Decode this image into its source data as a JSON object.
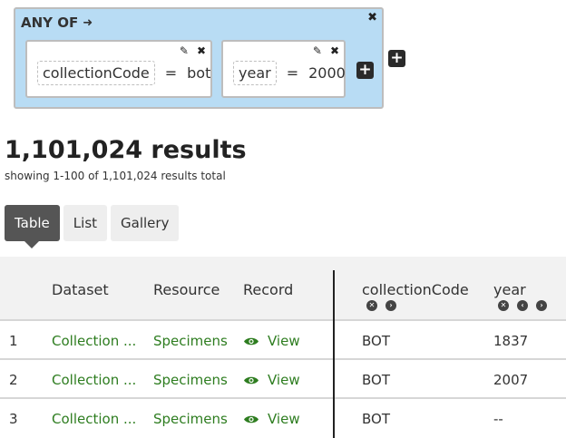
{
  "filter": {
    "group_title": "ANY OF",
    "clauses": [
      {
        "field": "collectionCode",
        "op": "=",
        "value": "bot"
      },
      {
        "field": "year",
        "op": "=",
        "value": "2000"
      }
    ]
  },
  "results": {
    "count": "1,101,024 results",
    "showing": "showing 1-100 of 1,101,024 results total"
  },
  "tabs": [
    {
      "label": "Table",
      "active": true
    },
    {
      "label": "List",
      "active": false
    },
    {
      "label": "Gallery",
      "active": false
    }
  ],
  "table": {
    "headers": [
      "Dataset",
      "Resource",
      "Record",
      "collectionCode",
      "year"
    ],
    "rows": [
      {
        "num": "1",
        "dataset": "Collection ...",
        "resource": "Specimens",
        "record": "View",
        "collectionCode": "BOT",
        "year": "1837"
      },
      {
        "num": "2",
        "dataset": "Collection ...",
        "resource": "Specimens",
        "record": "View",
        "collectionCode": "BOT",
        "year": "2007"
      },
      {
        "num": "3",
        "dataset": "Collection ...",
        "resource": "Specimens",
        "record": "View",
        "collectionCode": "BOT",
        "year": "--"
      }
    ]
  },
  "icons": {
    "edit": "pencil-icon",
    "remove": "close-icon",
    "add": "plus-icon",
    "view": "eye-icon",
    "colors": {
      "link": "#2e7d20",
      "group_bg": "#b8dcf4",
      "active_tab": "#555555"
    }
  }
}
